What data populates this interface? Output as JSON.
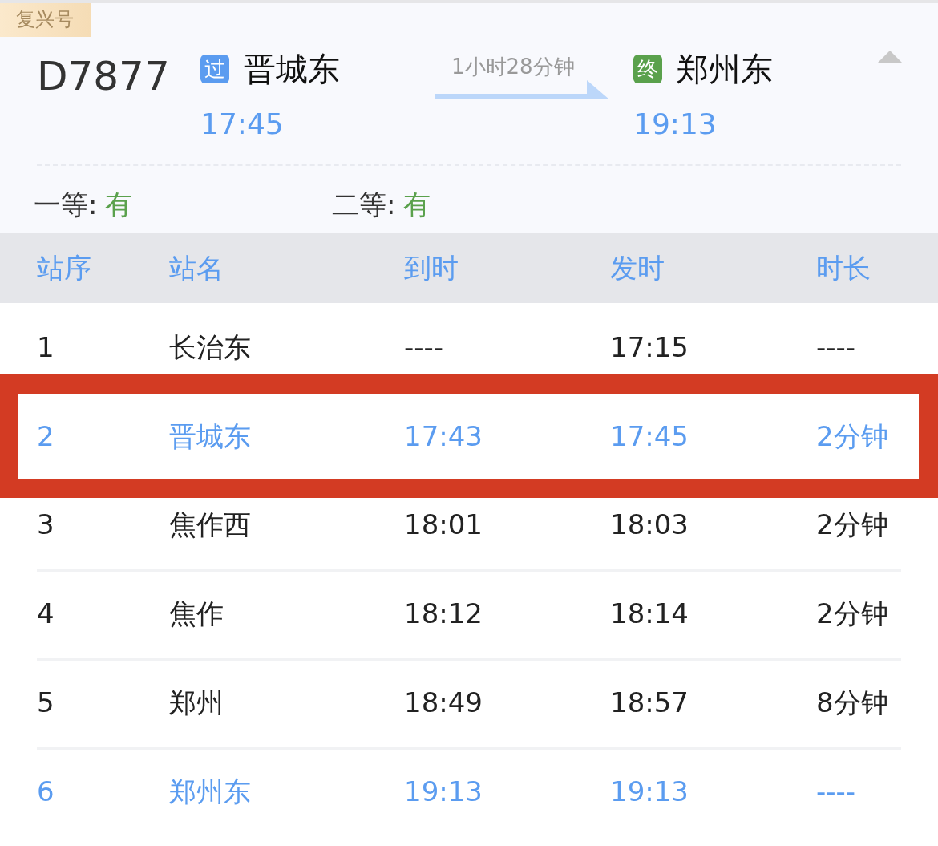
{
  "train_type": "复兴号",
  "train_number": "D7877",
  "from": {
    "badge": "过",
    "kind": "passing",
    "station": "晋城东",
    "time": "17:45"
  },
  "duration": "1小时28分钟",
  "to": {
    "badge": "终",
    "kind": "terminal",
    "station": "郑州东",
    "time": "19:13"
  },
  "expanded": true,
  "seats": [
    {
      "label": "一等:",
      "availability": "有"
    },
    {
      "label": "二等:",
      "availability": "有"
    }
  ],
  "table": {
    "columns": [
      "站序",
      "站名",
      "到时",
      "发时",
      "时长"
    ],
    "rows": [
      {
        "cells": [
          "1",
          "长治东",
          "----",
          "17:15",
          "----"
        ],
        "highlighted": false,
        "boxed": false
      },
      {
        "cells": [
          "2",
          "晋城东",
          "17:43",
          "17:45",
          "2分钟"
        ],
        "highlighted": true,
        "boxed": true
      },
      {
        "cells": [
          "3",
          "焦作西",
          "18:01",
          "18:03",
          "2分钟"
        ],
        "highlighted": false,
        "boxed": false
      },
      {
        "cells": [
          "4",
          "焦作",
          "18:12",
          "18:14",
          "2分钟"
        ],
        "highlighted": false,
        "boxed": false
      },
      {
        "cells": [
          "5",
          "郑州",
          "18:49",
          "18:57",
          "8分钟"
        ],
        "highlighted": false,
        "boxed": false
      },
      {
        "cells": [
          "6",
          "郑州东",
          "19:13",
          "19:13",
          "----"
        ],
        "highlighted": true,
        "boxed": false
      }
    ]
  }
}
